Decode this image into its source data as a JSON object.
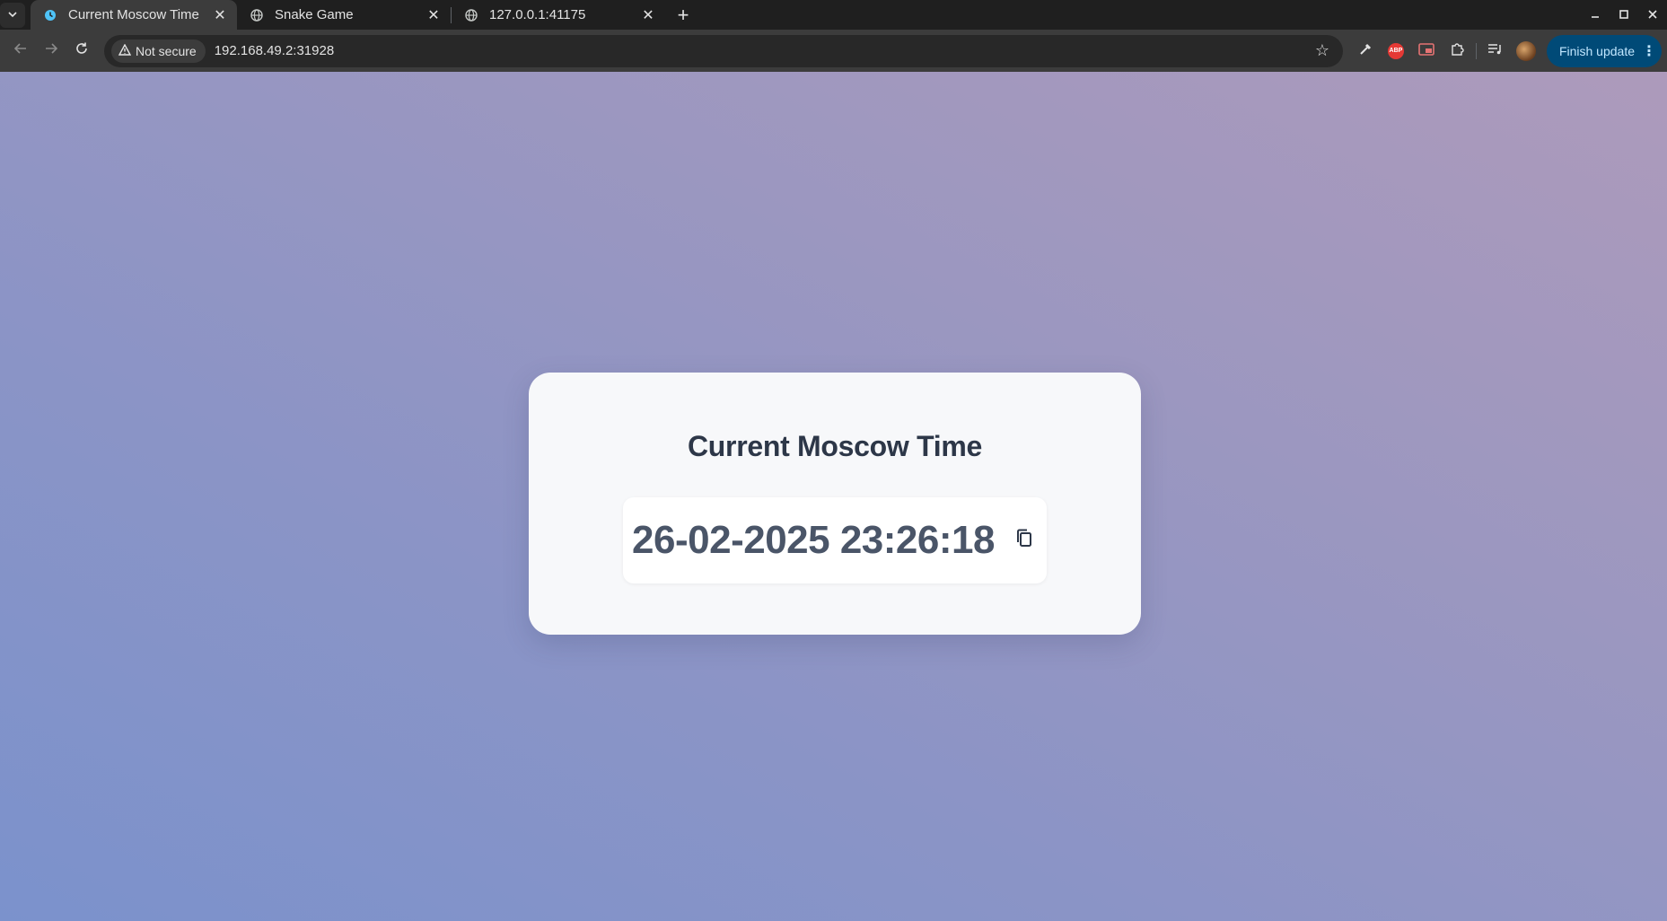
{
  "browser": {
    "tabs": [
      {
        "title": "Current Moscow Time",
        "active": true,
        "favicon": "clock-icon"
      },
      {
        "title": "Snake Game",
        "active": false,
        "favicon": "globe-icon"
      },
      {
        "title": "127.0.0.1:41175",
        "active": false,
        "favicon": "globe-icon"
      }
    ],
    "security_label": "Not secure",
    "url": "192.168.49.2:31928",
    "update_button_label": "Finish update"
  },
  "page": {
    "heading": "Current Moscow Time",
    "time": "26-02-2025 23:26:18"
  },
  "colors": {
    "background_gradient_start": "#7b92cc",
    "background_gradient_end": "#ad9abb",
    "card": "#f7f8fa",
    "heading": "#2d3748",
    "time_text": "#4a5568"
  }
}
